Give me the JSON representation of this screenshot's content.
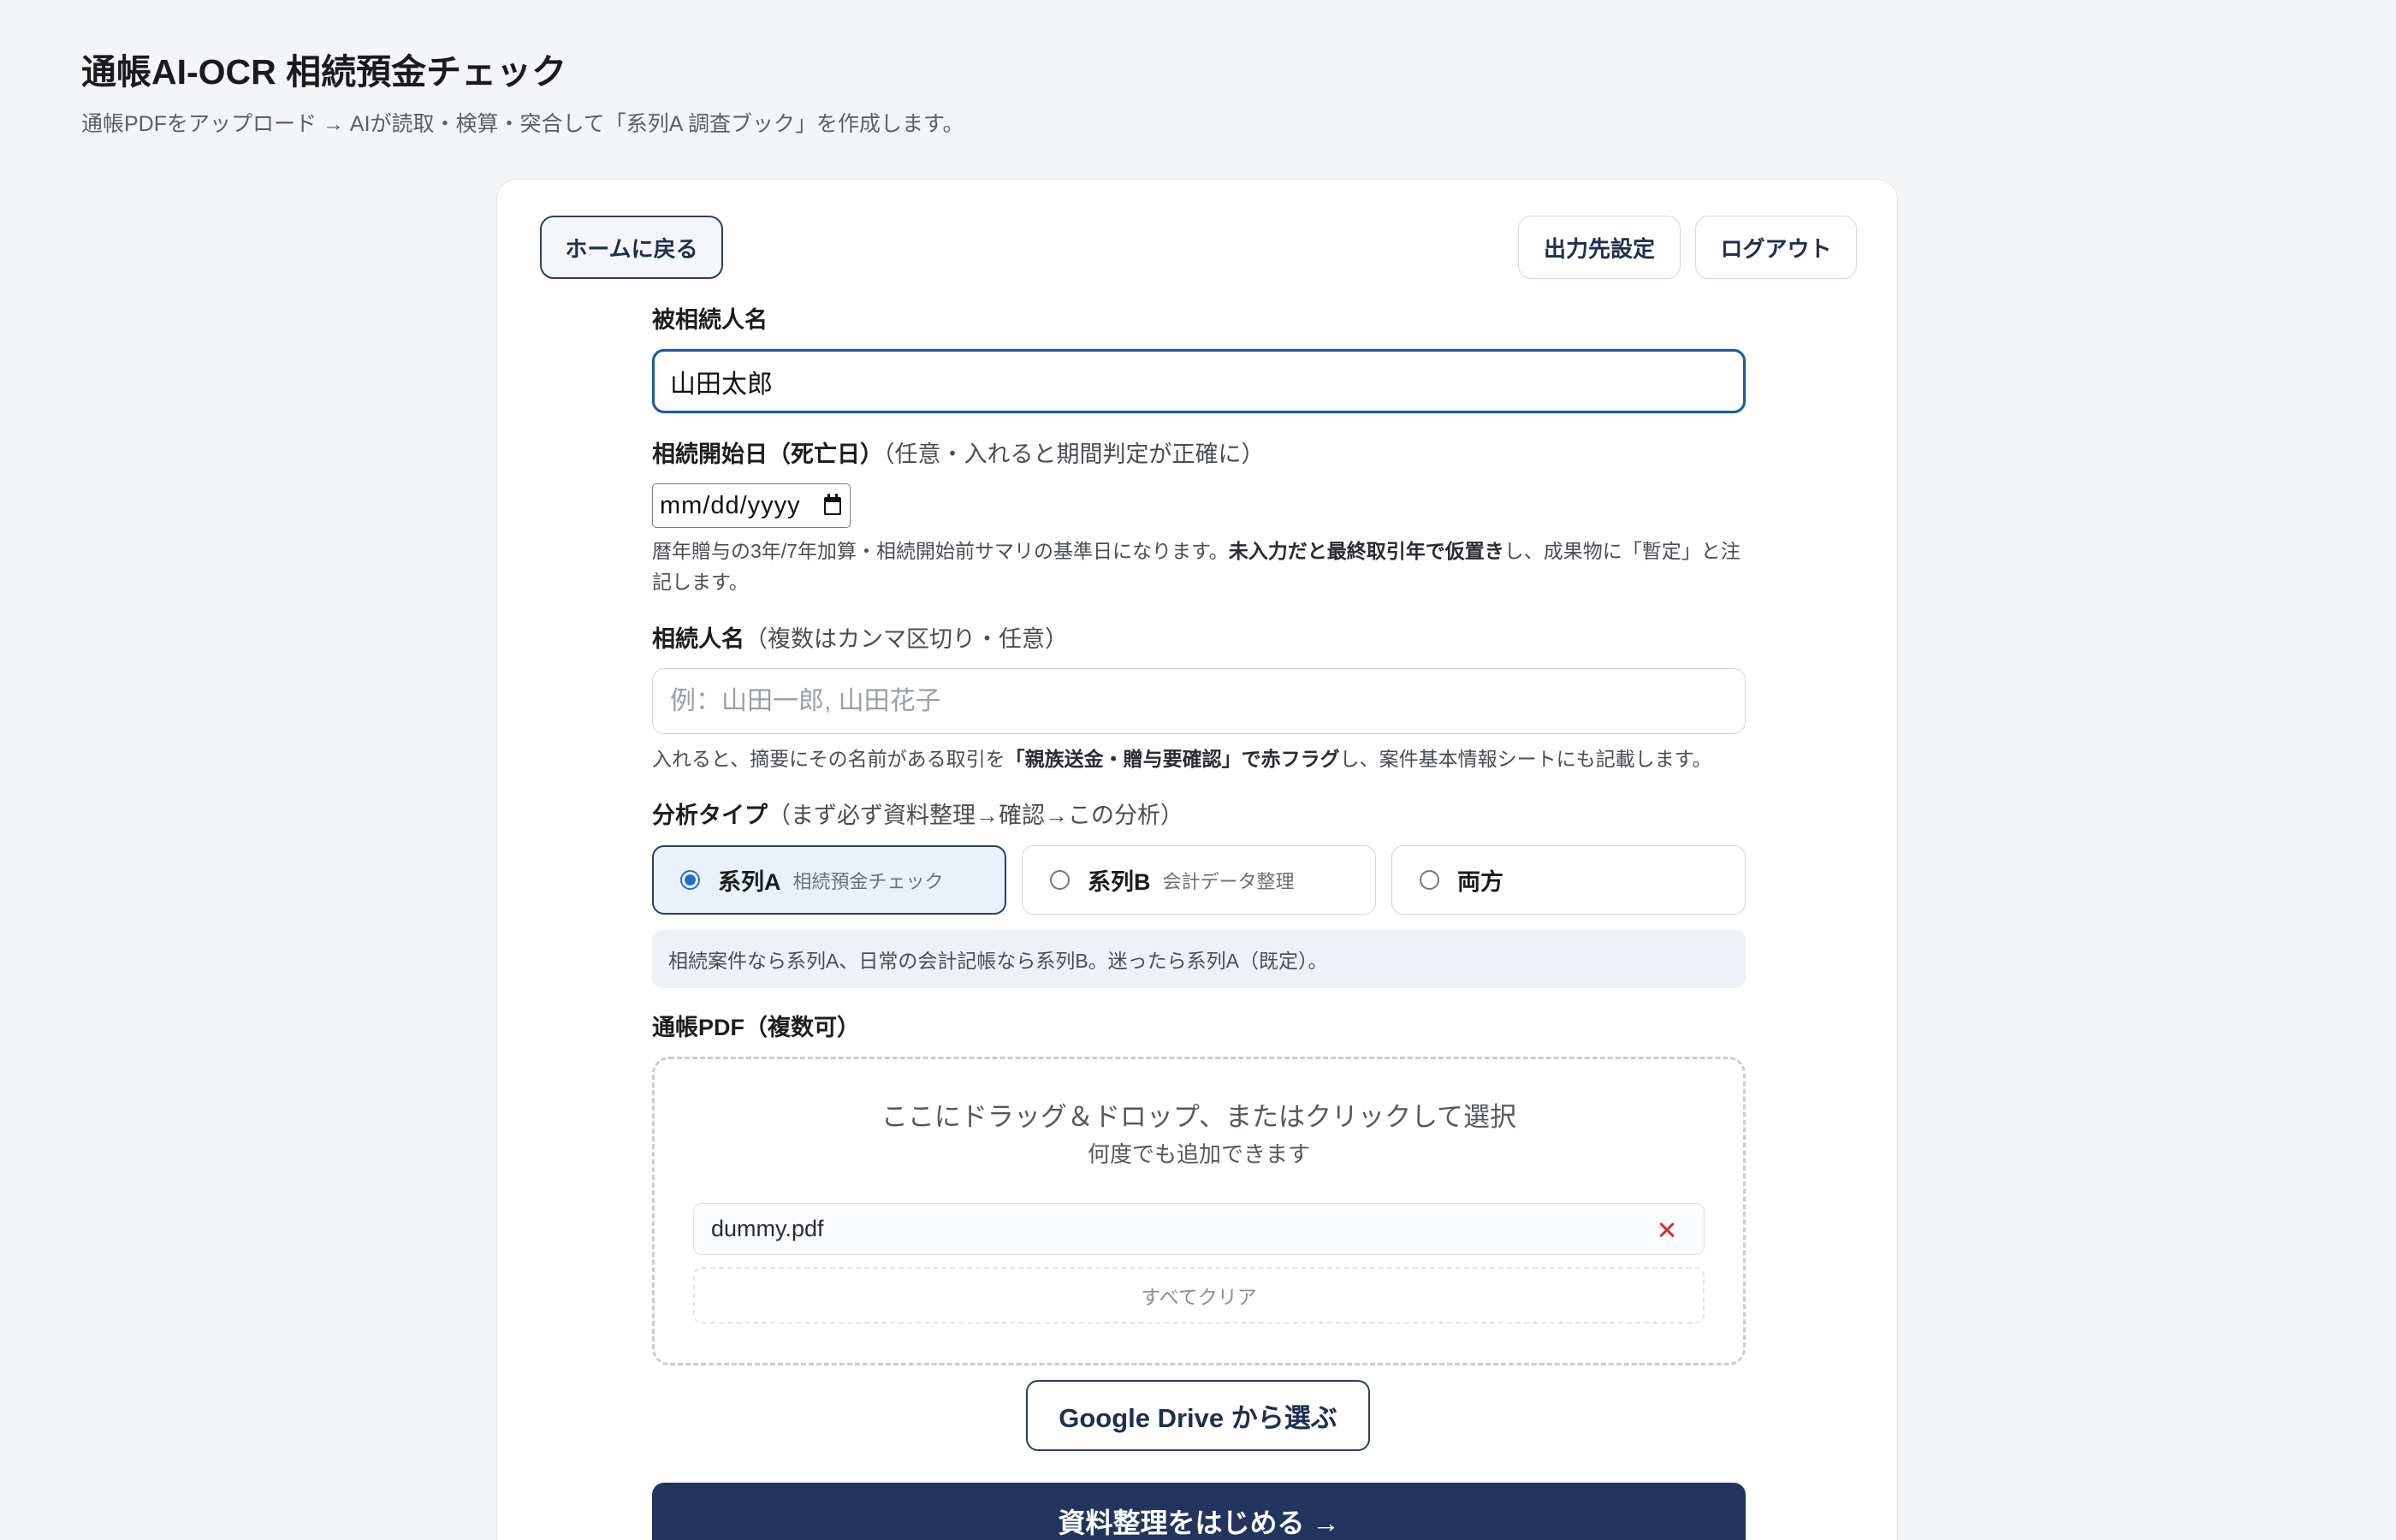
{
  "header": {
    "title": "通帳AI-OCR 相続預金チェック",
    "subtitle": "通帳PDFをアップロード → AIが読取・検算・突合して「系列A 調査ブック」を作成します。"
  },
  "nav": {
    "home_label": "ホームに戻る",
    "output_settings_label": "出力先設定",
    "logout_label": "ログアウト"
  },
  "form": {
    "decedent": {
      "label": "被相続人名",
      "value": "山田太郎"
    },
    "start_date": {
      "label": "相続開始日（死亡日）",
      "label_note": "（任意・入れると期間判定が正確に）",
      "value_display": "mm/dd/yyyy",
      "help_pre": "暦年贈与の3年/7年加算・相続開始前サマリの基準日になります。",
      "help_bold": "未入力だと最終取引年で仮置き",
      "help_post": "し、成果物に「暫定」と注記します。"
    },
    "heirs": {
      "label": "相続人名",
      "label_note": "（複数はカンマ区切り・任意）",
      "placeholder": "例：山田一郎, 山田花子",
      "help_pre": "入れると、摘要にその名前がある取引を",
      "help_bold": "「親族送金・贈与要確認」で赤フラグ",
      "help_post": "し、案件基本情報シートにも記載します。"
    },
    "analysis_type": {
      "label": "分析タイプ",
      "label_note": "（まず必ず資料整理→確認→この分析）",
      "options": [
        {
          "label": "系列A",
          "desc": "相続預金チェック",
          "selected": true
        },
        {
          "label": "系列B",
          "desc": "会計データ整理",
          "selected": false
        },
        {
          "label": "両方",
          "selected": false
        }
      ],
      "info": "相続案件なら系列A、日常の会計記帳なら系列B。迷ったら系列A（既定）。"
    },
    "pdf": {
      "label": "通帳PDF（複数可）",
      "drop_text": "ここにドラッグ＆ドロップ、またはクリックして選択",
      "drop_subtext": "何度でも追加できます",
      "files": [
        {
          "name": "dummy.pdf"
        }
      ],
      "clear_all_label": "すべてクリア",
      "drive_button_label": "Google Drive から選ぶ"
    },
    "submit_label": "資料整理をはじめる →"
  },
  "icons": {
    "date_picker": "calendar-icon",
    "remove_file": "close-icon",
    "option_selector": "radio-icon"
  },
  "colors": {
    "accent": "#22355e",
    "focus": "#1b5aa6",
    "danger": "#d0342c",
    "selected_bg": "#eaf1fb",
    "radio": "#1a6fd8"
  }
}
